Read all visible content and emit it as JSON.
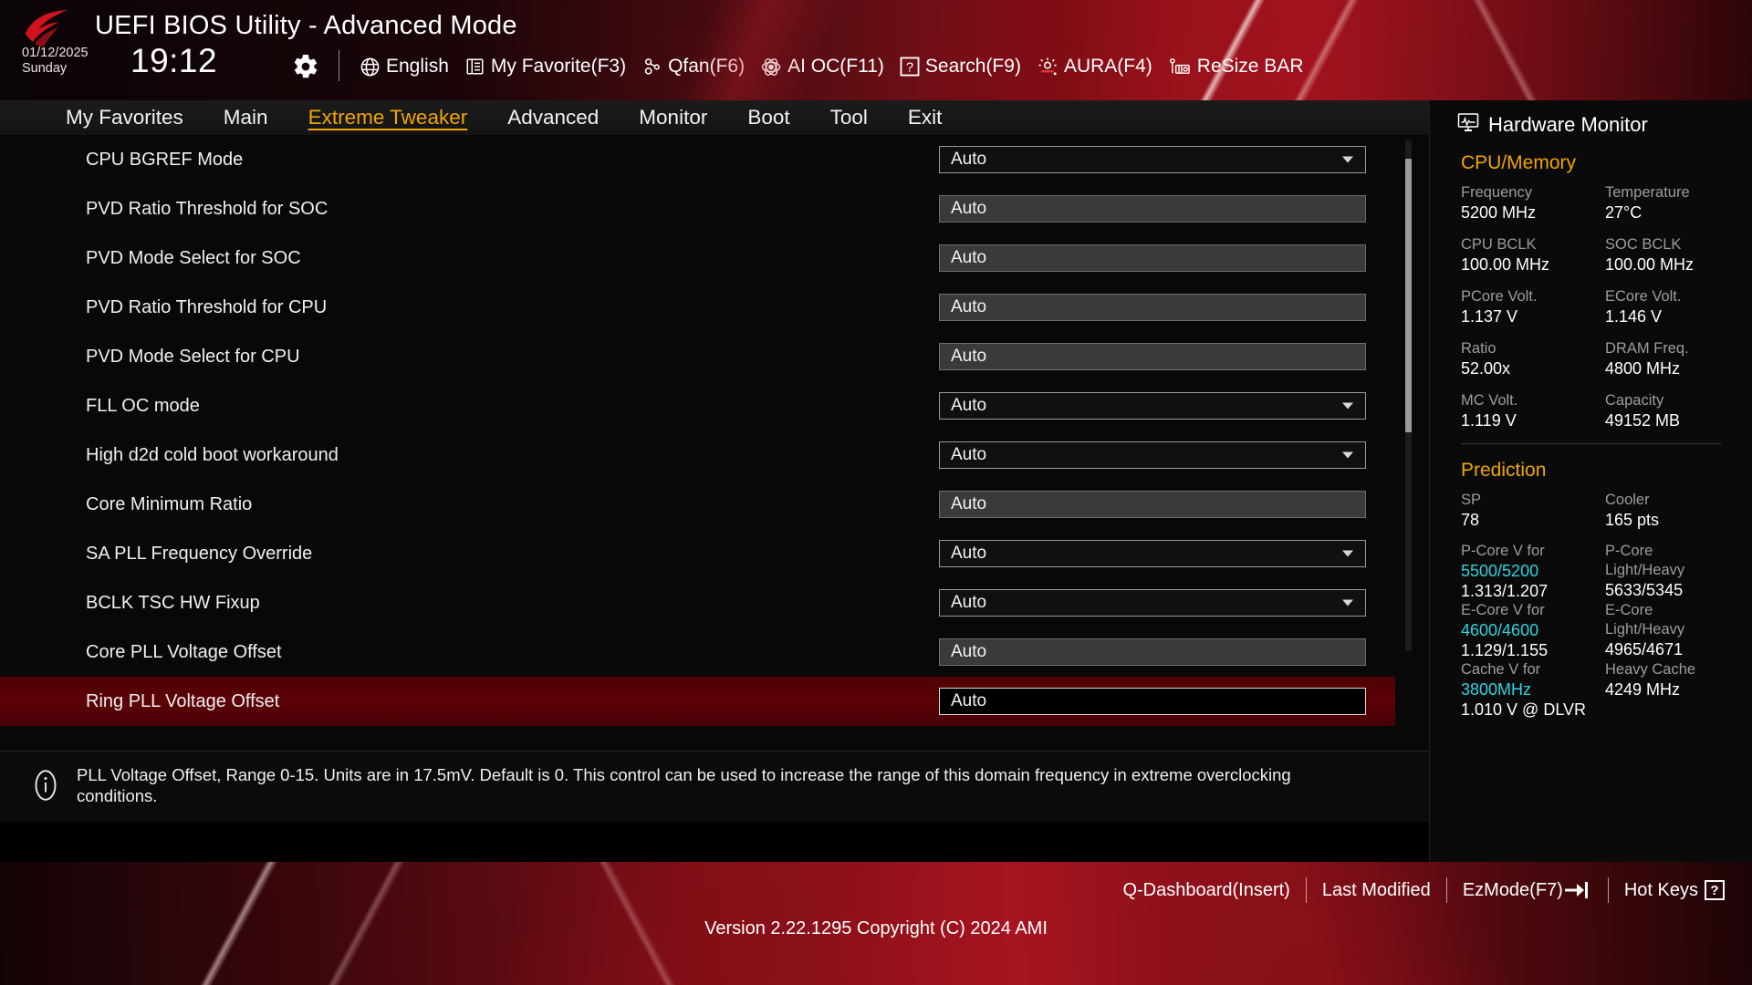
{
  "header": {
    "title": "UEFI BIOS Utility - Advanced Mode",
    "date": "01/12/2025",
    "day": "Sunday",
    "time": "19:12",
    "gear_icon": "gear-icon",
    "toolbar": [
      {
        "icon": "globe-icon",
        "label": "English"
      },
      {
        "icon": "list-icon",
        "label": "My Favorite(F3)"
      },
      {
        "icon": "fan-icon",
        "label": "Qfan(F6)"
      },
      {
        "icon": "aioc-icon",
        "label": "AI OC(F11)"
      },
      {
        "icon": "question-icon",
        "label": "Search(F9)"
      },
      {
        "icon": "aura-icon",
        "label": "AURA(F4)"
      },
      {
        "icon": "resizebar-icon",
        "label": "ReSize BAR"
      }
    ]
  },
  "nav": {
    "tabs": [
      {
        "label": "My Favorites",
        "active": false
      },
      {
        "label": "Main",
        "active": false
      },
      {
        "label": "Extreme Tweaker",
        "active": true
      },
      {
        "label": "Advanced",
        "active": false
      },
      {
        "label": "Monitor",
        "active": false
      },
      {
        "label": "Boot",
        "active": false
      },
      {
        "label": "Tool",
        "active": false
      },
      {
        "label": "Exit",
        "active": false
      }
    ]
  },
  "settings": [
    {
      "label": "CPU BGREF Mode",
      "value": "Auto",
      "control": "dropdown",
      "selected": false
    },
    {
      "label": "PVD Ratio Threshold for SOC",
      "value": "Auto",
      "control": "plain",
      "selected": false
    },
    {
      "label": "PVD Mode Select for SOC",
      "value": "Auto",
      "control": "plain",
      "selected": false
    },
    {
      "label": "PVD Ratio Threshold for CPU",
      "value": "Auto",
      "control": "plain",
      "selected": false
    },
    {
      "label": "PVD Mode Select for CPU",
      "value": "Auto",
      "control": "plain",
      "selected": false
    },
    {
      "label": "FLL OC mode",
      "value": "Auto",
      "control": "dropdown",
      "selected": false
    },
    {
      "label": "High d2d cold boot workaround",
      "value": "Auto",
      "control": "dropdown",
      "selected": false
    },
    {
      "label": "Core Minimum Ratio",
      "value": "Auto",
      "control": "plain",
      "selected": false
    },
    {
      "label": "SA PLL Frequency Override",
      "value": "Auto",
      "control": "dropdown",
      "selected": false
    },
    {
      "label": "BCLK TSC HW Fixup",
      "value": "Auto",
      "control": "dropdown",
      "selected": false
    },
    {
      "label": "Core PLL Voltage Offset",
      "value": "Auto",
      "control": "plain",
      "selected": false
    },
    {
      "label": "Ring PLL Voltage Offset",
      "value": "Auto",
      "control": "editing",
      "selected": true
    }
  ],
  "help": {
    "icon": "info-icon",
    "text": "PLL Voltage Offset, Range 0-15. Units are in 17.5mV. Default is 0. This control can be used to increase the range of this domain frequency in extreme overclocking conditions."
  },
  "hardware_monitor": {
    "icon": "monitor-icon",
    "title": "Hardware Monitor",
    "cpu_memory": {
      "section_title": "CPU/Memory",
      "pairs": [
        [
          {
            "key": "Frequency",
            "value": "5200 MHz"
          },
          {
            "key": "Temperature",
            "value": "27°C"
          }
        ],
        [
          {
            "key": "CPU BCLK",
            "value": "100.00 MHz"
          },
          {
            "key": "SOC BCLK",
            "value": "100.00 MHz"
          }
        ],
        [
          {
            "key": "PCore Volt.",
            "value": "1.137 V"
          },
          {
            "key": "ECore Volt.",
            "value": "1.146 V"
          }
        ],
        [
          {
            "key": "Ratio",
            "value": "52.00x"
          },
          {
            "key": "DRAM Freq.",
            "value": "4800 MHz"
          }
        ],
        [
          {
            "key": "MC Volt.",
            "value": "1.119 V"
          },
          {
            "key": "Capacity",
            "value": "49152 MB"
          }
        ]
      ]
    },
    "prediction": {
      "section_title": "Prediction",
      "sp_label": "SP",
      "sp_value": "78",
      "cooler_label": "Cooler",
      "cooler_value": "165 pts",
      "left": {
        "pcore_key_1": "P-Core V for",
        "pcore_key_2": "5500/5200",
        "pcore_value": "1.313/1.207",
        "ecore_key_1": "E-Core V for",
        "ecore_key_2": "4600/4600",
        "ecore_value": "1.129/1.155",
        "cache_key_1": "Cache V for",
        "cache_key_2": "3800MHz",
        "cache_value": "1.010 V @ DLVR"
      },
      "right": {
        "pcore_key_1": "P-Core",
        "pcore_key_2": "Light/Heavy",
        "pcore_value": "5633/5345",
        "ecore_key_1": "E-Core",
        "ecore_key_2": "Light/Heavy",
        "ecore_value": "4965/4671",
        "cache_key_1": "Heavy Cache",
        "cache_value": "4249 MHz"
      }
    }
  },
  "footer": {
    "links": [
      {
        "label": "Q-Dashboard(Insert)",
        "icon": ""
      },
      {
        "label": "Last Modified",
        "icon": ""
      },
      {
        "label": "EzMode(F7)",
        "icon": "arrow-into-icon"
      },
      {
        "label": "Hot Keys",
        "icon": "question-box-icon"
      }
    ],
    "version": "Version 2.22.1295 Copyright (C) 2024 AMI"
  },
  "colors": {
    "accent_yellow": "#f0a500",
    "accent_cyan": "#2fd3e0",
    "selected_red": "#5c0207",
    "rog_red": "#a61420"
  }
}
